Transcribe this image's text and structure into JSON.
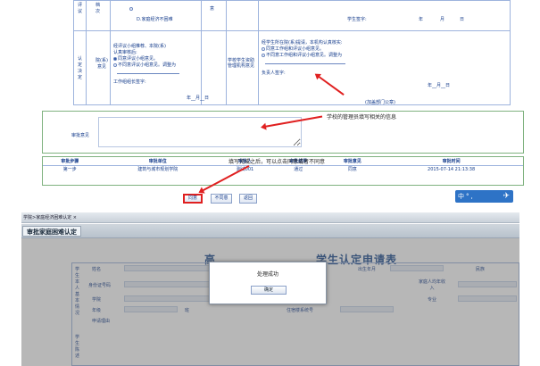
{
  "form": {
    "row0_labels": [
      "评议",
      "档次"
    ],
    "row0_item_c": "C.家庭经济困难",
    "row0_item_d": "D.家庭经济不困难",
    "row0_right": "意",
    "student_sign": "学生签字:",
    "date_year": "年",
    "date_month": "月",
    "date_day": "日",
    "row1_label_left": "认定决定",
    "col_yuan": "院(系)意见",
    "yuan_text1": "经评议小组推荐、本院(系)",
    "yuan_text2": "认真审核后:",
    "yuan_opt1": "同意评议小组意见。",
    "yuan_opt2": "不同意评议小组意见。调整为",
    "yuan_sign": "工作组组长签字:",
    "school_label": "学校学生资助管理机构意见",
    "school_text1": "经学生所在院(系)提请，本机构认真核实:",
    "school_opt1": "同意工作组和评议小组意见。",
    "school_opt2": "不同意工作组和评议小组意见。调整为",
    "school_sign": "负责人签字:",
    "stamp": "(加盖部门公章)"
  },
  "review": {
    "label": "审批意见"
  },
  "annotations": {
    "admin_note": "学校的管理员填写相关的信息",
    "done_note": "填写完成之后，可以点击同意或者不同意"
  },
  "steps": {
    "headers": [
      "审批步骤",
      "审批单位",
      "审批人",
      "审批结果",
      "审批意见",
      "审批时间"
    ],
    "row": [
      "第一步",
      "建筑与城市规划学院",
      "测试001",
      "通过",
      "同意",
      "2015-07-14 21:13:38"
    ]
  },
  "buttons": {
    "agree": "同意",
    "disagree": "不同意",
    "back": "返回"
  },
  "tray": {
    "text": "中°,"
  },
  "screen2": {
    "breadcrumb": "学院>家庭经济困难认定 ×",
    "tab": "审批家庭困难认定",
    "title_left": "高",
    "title_right": "学生认定申请表",
    "fields": {
      "name": "姓名",
      "birth": "出生年月",
      "ethnic": "民族",
      "id_no": "身份证号码",
      "household_pop": "家庭人均年收入",
      "college": "学院",
      "major": "专业",
      "grade": "年级",
      "class": "班",
      "contact": "联系方式",
      "dorm": "住宿楼系统号",
      "reason": "申请理由"
    },
    "side_label1": "学生本人基本情况",
    "side_label2": "学生陈述",
    "dialog_msg": "处理成功",
    "dialog_ok": "确定"
  }
}
